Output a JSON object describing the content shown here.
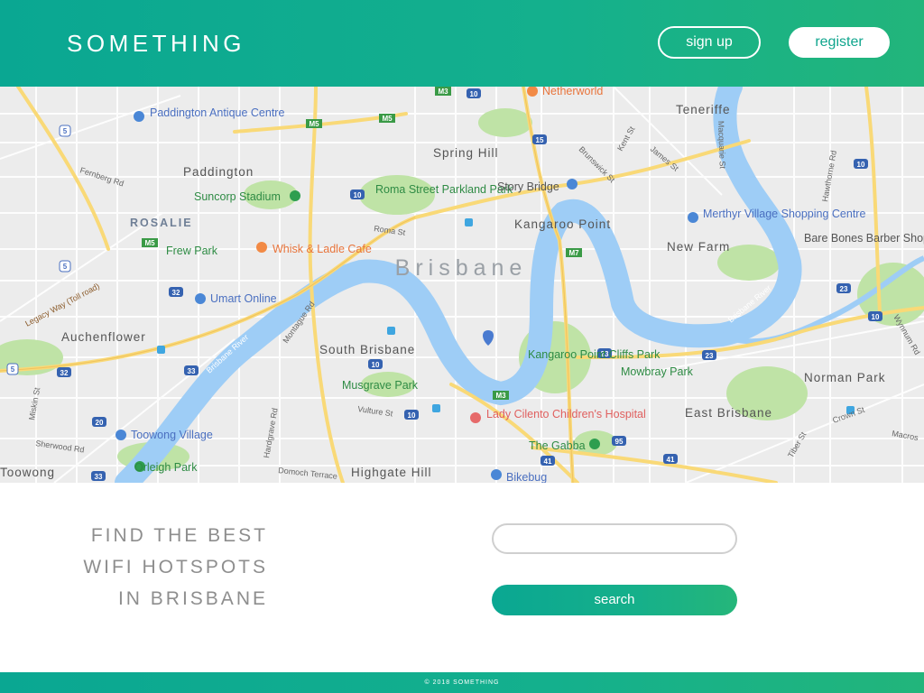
{
  "header": {
    "logo": "SOMETHING",
    "signup_label": "sign up",
    "register_label": "register"
  },
  "map": {
    "city_label": "Brisbane",
    "place_labels": [
      "Paddington Antique Centre",
      "Paddington",
      "Suncorp Stadium",
      "ROSALIE",
      "Frew Park",
      "Whisk & Ladle Cafe",
      "Umart Online",
      "Auchenflower",
      "Toowong Village",
      "Orleigh Park",
      "Toowong",
      "Spring Hill",
      "Roma Street Parkland Park",
      "Story Bridge",
      "Kangaroo Point",
      "Netherworld",
      "Teneriffe",
      "Merthyr Village Shopping Centre",
      "New Farm",
      "Bare Bones Barber Shop",
      "South Brisbane",
      "Musgrave Park",
      "Kangaroo Point Cliffs Park",
      "Mowbray Park",
      "Norman Park",
      "East Brisbane",
      "Lady Cilento Children's Hospital",
      "The Gabba",
      "Highgate Hill",
      "Bikebug"
    ],
    "street_labels": [
      "Fernberg Rd",
      "Legacy Way (Toll road)",
      "Montague Rd",
      "Brisbane River",
      "Roma St",
      "Vulture St",
      "Hardgrave Rd",
      "Domoch Terrace",
      "Sherwood Rd",
      "Miskin St",
      "Brunswick St",
      "Kent St",
      "James St",
      "Macquarie St",
      "Hawthorne Rd",
      "Wynnum Rd",
      "Tiber St",
      "Crown St",
      "Macros"
    ],
    "route_shields": [
      "M3",
      "M5",
      "M7",
      "5",
      "10",
      "15",
      "20",
      "23",
      "32",
      "33",
      "41",
      "95"
    ]
  },
  "tagline": {
    "line1": "FIND THE BEST",
    "line2": "WIFI HOTSPOTS",
    "line3": "IN BRISBANE"
  },
  "search": {
    "placeholder": "",
    "button_label": "search"
  },
  "footer": {
    "copyright": "© 2018 SOMETHING"
  },
  "colors": {
    "brand_teal": "#0aa792",
    "brand_green": "#22b57b",
    "river": "#9ecdf6",
    "park": "#bfe3a6",
    "road_major": "#f9d977",
    "poi_orange": "#f28a45",
    "poi_blue": "#4a87d6",
    "poi_green": "#2e9e4f"
  }
}
